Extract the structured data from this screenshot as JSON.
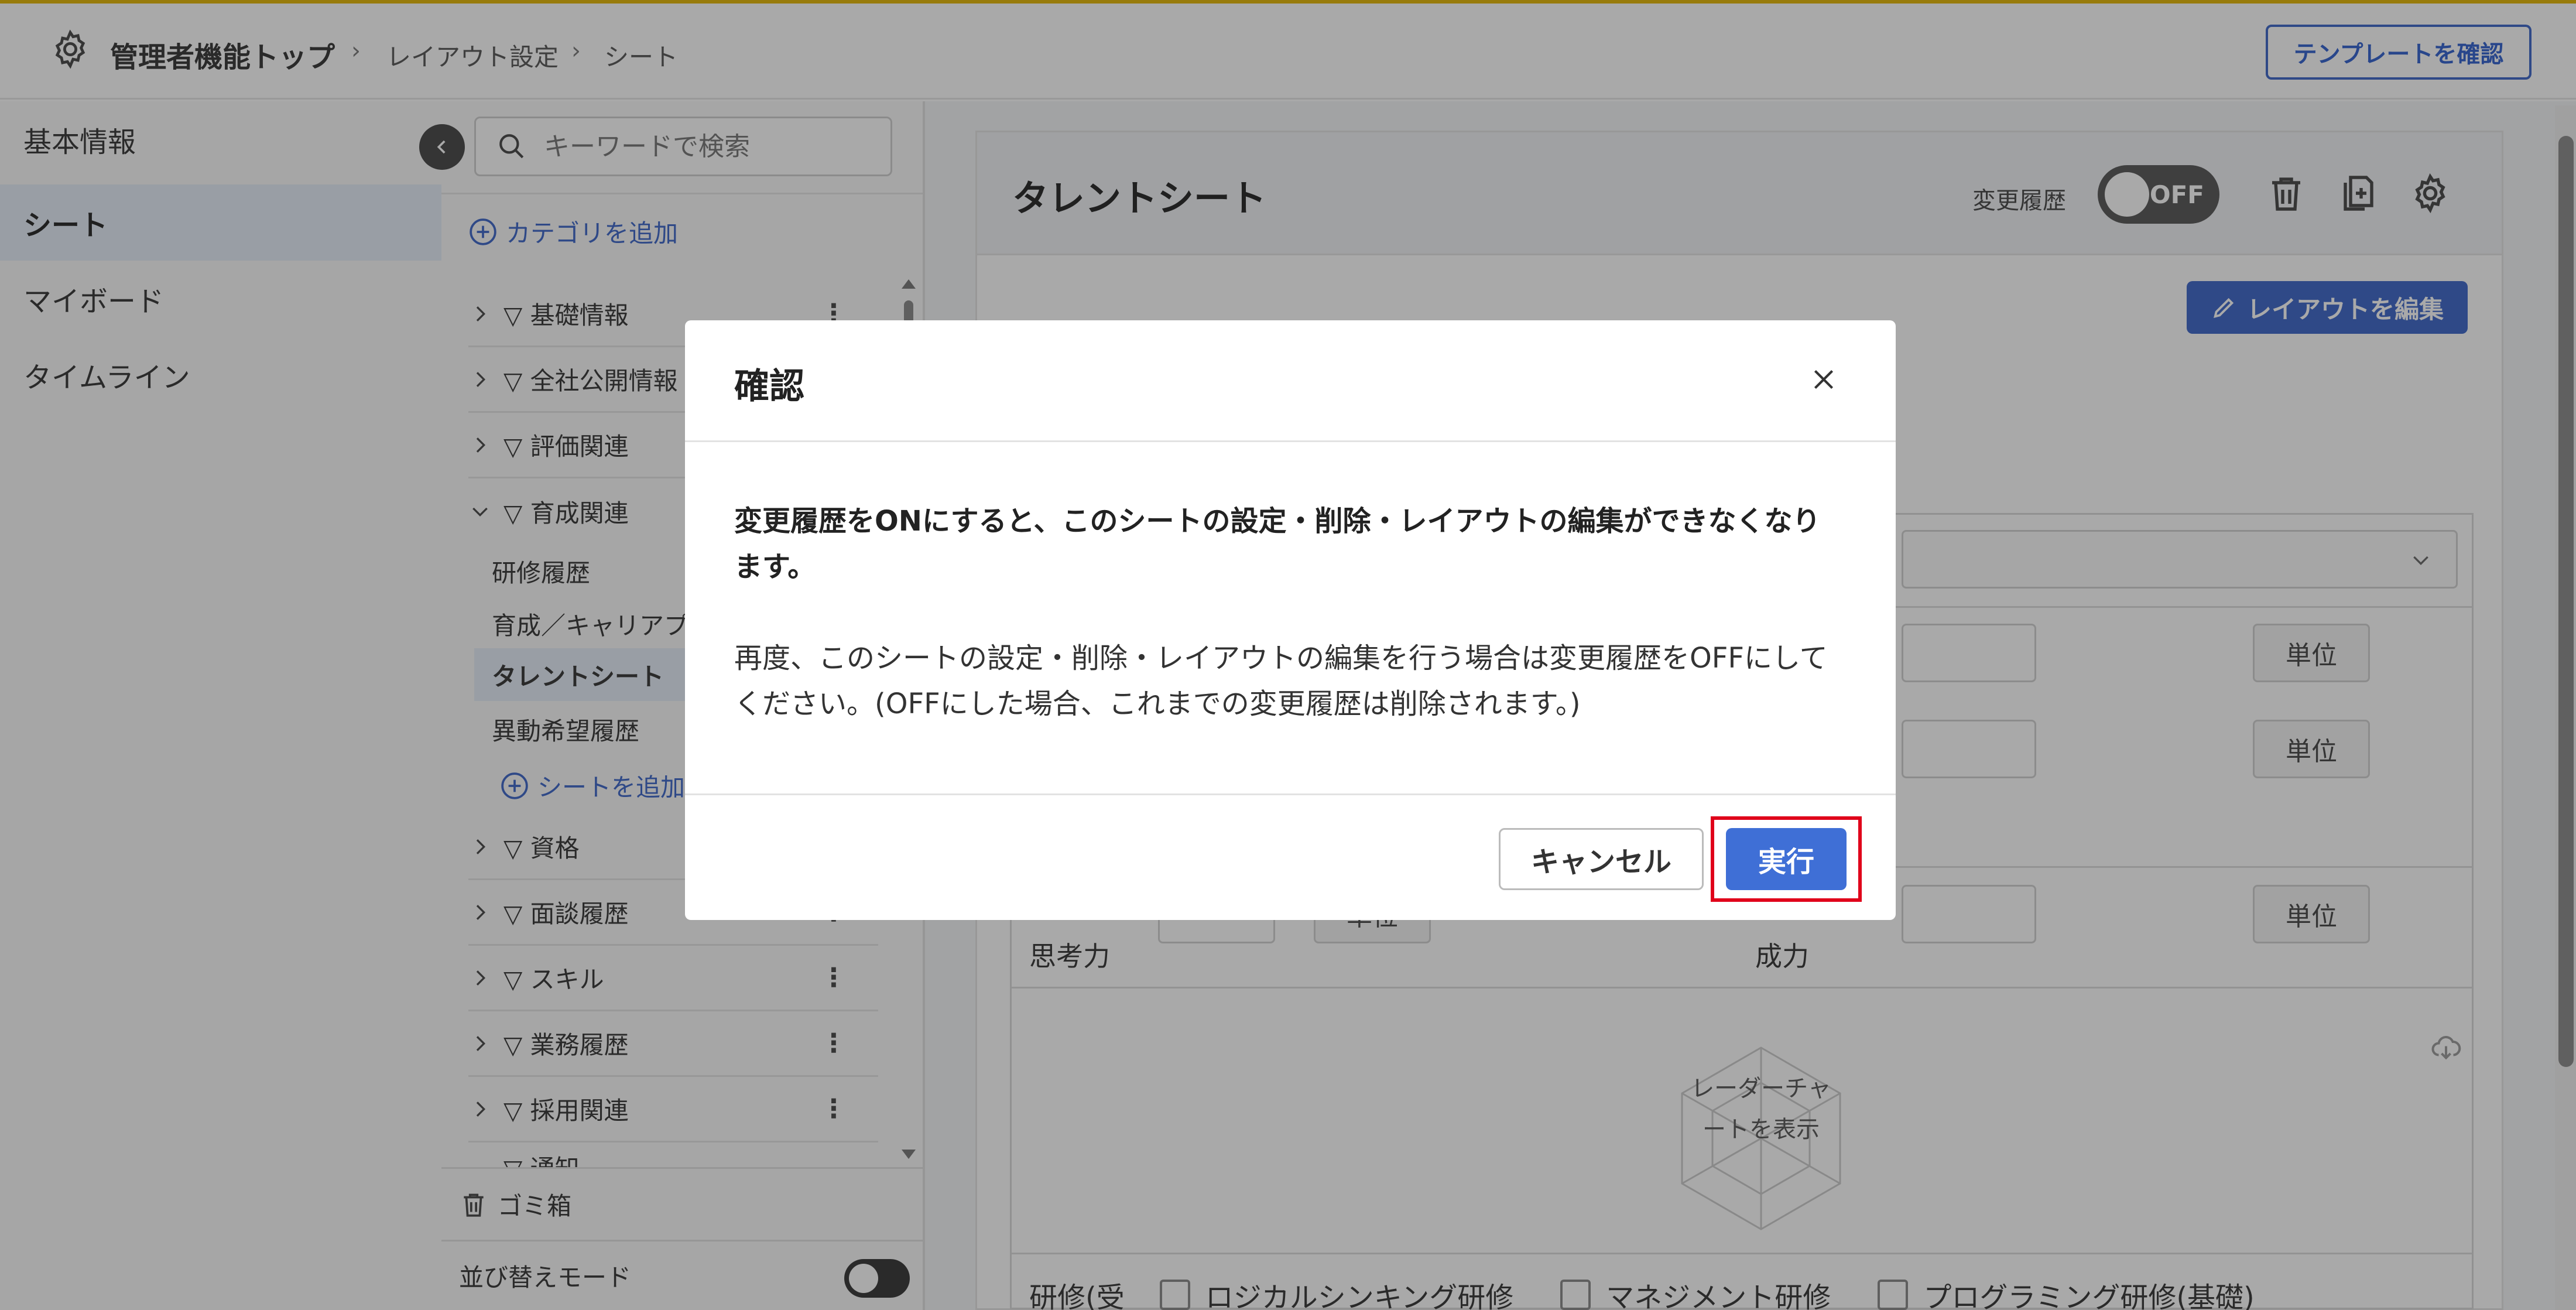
{
  "header": {
    "root": "管理者機能トップ",
    "crumb1": "レイアウト設定",
    "crumb2": "シート",
    "template_button": "テンプレートを確認"
  },
  "leftnav": {
    "items": [
      {
        "label": "基本情報"
      },
      {
        "label": "シート"
      },
      {
        "label": "マイボード"
      },
      {
        "label": "タイムライン"
      }
    ]
  },
  "tree": {
    "search_placeholder": "キーワードで検索",
    "add_category": "カテゴリを追加",
    "categories": [
      {
        "label": "▽ 基礎情報"
      },
      {
        "label": "▽ 全社公開情報"
      },
      {
        "label": "▽ 評価関連"
      },
      {
        "label": "▽ 育成関連"
      },
      {
        "label": "▽ 資格"
      },
      {
        "label": "▽ 面談履歴"
      },
      {
        "label": "▽ スキル"
      },
      {
        "label": "▽ 業務履歴"
      },
      {
        "label": "▽ 採用関連"
      },
      {
        "label": "▽ 通知"
      }
    ],
    "sub_items": [
      {
        "label": "研修履歴"
      },
      {
        "label": "育成／キャリアプラン"
      },
      {
        "label": "タレントシート"
      },
      {
        "label": "異動希望履歴"
      }
    ],
    "add_sheet": "シートを追加",
    "trash": "ゴミ箱",
    "sort_mode": "並び替えモード"
  },
  "main": {
    "sheet_title": "タレントシート",
    "history_label": "変更履歴",
    "history_toggle": "OFF",
    "edit_layout": "レイアウトを編集",
    "unit": "単位",
    "label_left": "思考力",
    "label_right": "成力",
    "radar_text": "レーダーチャートを表示",
    "row_label": "研修(受",
    "checkboxes": [
      "ロジカルシンキング研修",
      "マネジメント研修",
      "プログラミング研修(基礎)"
    ]
  },
  "modal": {
    "title": "確認",
    "message_bold": "変更履歴をONにすると、このシートの設定・削除・レイアウトの編集ができなくなります。",
    "message": "再度、このシートの設定・削除・レイアウトの編集を行う場合は変更履歴をOFFにしてください。(OFFにした場合、これまでの変更履歴は削除されます。)",
    "cancel": "キャンセル",
    "execute": "実行"
  },
  "colors": {
    "accent": "#3a64c8",
    "highlight": "#e0001a",
    "top_line": "#e4b500"
  }
}
